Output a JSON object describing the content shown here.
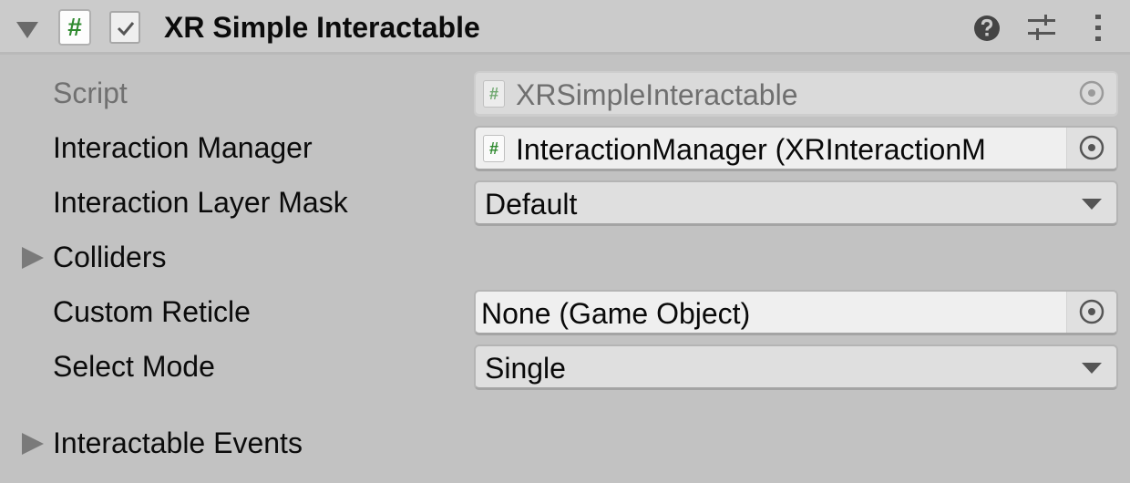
{
  "component": {
    "title": "XR Simple Interactable",
    "enabled": true,
    "expanded": true,
    "icon": "csharp-script-icon"
  },
  "header_icons": {
    "help": "help-icon",
    "presets": "presets-icon",
    "menu": "kebab-menu-icon"
  },
  "fields": {
    "script": {
      "label": "Script",
      "value": "XRSimpleInteractable",
      "disabled": true
    },
    "interaction_manager": {
      "label": "Interaction Manager",
      "value": "InteractionManager (XRInteractionM"
    },
    "interaction_layer_mask": {
      "label": "Interaction Layer Mask",
      "value": "Default"
    },
    "colliders": {
      "label": "Colliders",
      "expanded": false
    },
    "custom_reticle": {
      "label": "Custom Reticle",
      "value": "None (Game Object)"
    },
    "select_mode": {
      "label": "Select Mode",
      "value": "Single"
    },
    "interactable_events": {
      "label": "Interactable Events",
      "expanded": false
    }
  },
  "glyphs": {
    "hash": "#"
  }
}
